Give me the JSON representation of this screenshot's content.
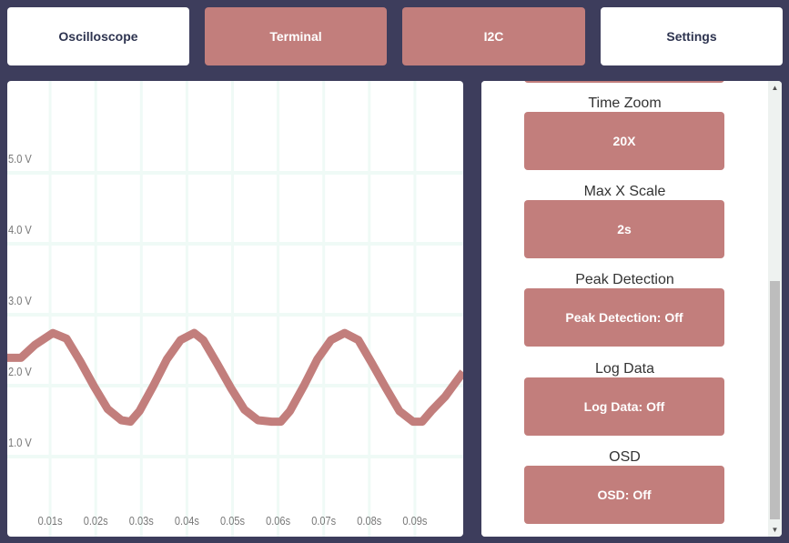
{
  "tabs": [
    {
      "label": "Oscilloscope"
    },
    {
      "label": "Terminal"
    },
    {
      "label": "I2C"
    },
    {
      "label": "Settings"
    }
  ],
  "settings": [
    {
      "label": "Time Zoom",
      "button": "20X"
    },
    {
      "label": "Max X Scale",
      "button": "2s"
    },
    {
      "label": "Peak Detection",
      "button": "Peak Detection: Off"
    },
    {
      "label": "Log Data",
      "button": "Log Data: Off"
    },
    {
      "label": "OSD",
      "button": "OSD: Off"
    }
  ],
  "scrollbar": {
    "up_icon": "triangle-up-icon",
    "down_icon": "triangle-down-icon"
  },
  "colors": {
    "background": "#3d3d5c",
    "accent": "#c27e7c",
    "trace": "#c27e7c",
    "grid": "#effaf6",
    "tab_text": "#2e3450"
  },
  "chart_data": {
    "type": "line",
    "title": "",
    "xlabel": "",
    "ylabel": "",
    "y_tick_labels": [
      "1.0 V",
      "2.0 V",
      "3.0 V",
      "4.0 V",
      "5.0 V"
    ],
    "y_tick_values": [
      1.0,
      2.0,
      3.0,
      4.0,
      5.0
    ],
    "x_tick_labels": [
      "0.01s",
      "0.02s",
      "0.03s",
      "0.04s",
      "0.05s",
      "0.06s",
      "0.07s",
      "0.08s",
      "0.09s"
    ],
    "x_tick_values": [
      0.01,
      0.02,
      0.03,
      0.04,
      0.05,
      0.06,
      0.07,
      0.08,
      0.09
    ],
    "xlim": [
      0.0,
      0.1
    ],
    "ylim": [
      0.0,
      6.0
    ],
    "grid": true,
    "series": [
      {
        "x": [
          0.0,
          0.003,
          0.006,
          0.01,
          0.013,
          0.016,
          0.019,
          0.022,
          0.025,
          0.027,
          0.029,
          0.032,
          0.035,
          0.038,
          0.041,
          0.043,
          0.046,
          0.049,
          0.052,
          0.055,
          0.058,
          0.06,
          0.062,
          0.065,
          0.068,
          0.071,
          0.074,
          0.077,
          0.08,
          0.083,
          0.086,
          0.089,
          0.091,
          0.093,
          0.096,
          0.1
        ],
        "y": [
          2.2,
          2.2,
          2.38,
          2.55,
          2.47,
          2.15,
          1.8,
          1.48,
          1.32,
          1.3,
          1.45,
          1.8,
          2.18,
          2.45,
          2.55,
          2.45,
          2.12,
          1.78,
          1.47,
          1.32,
          1.3,
          1.3,
          1.45,
          1.8,
          2.18,
          2.45,
          2.55,
          2.45,
          2.12,
          1.78,
          1.45,
          1.3,
          1.3,
          1.45,
          1.65,
          2.0
        ]
      }
    ]
  }
}
